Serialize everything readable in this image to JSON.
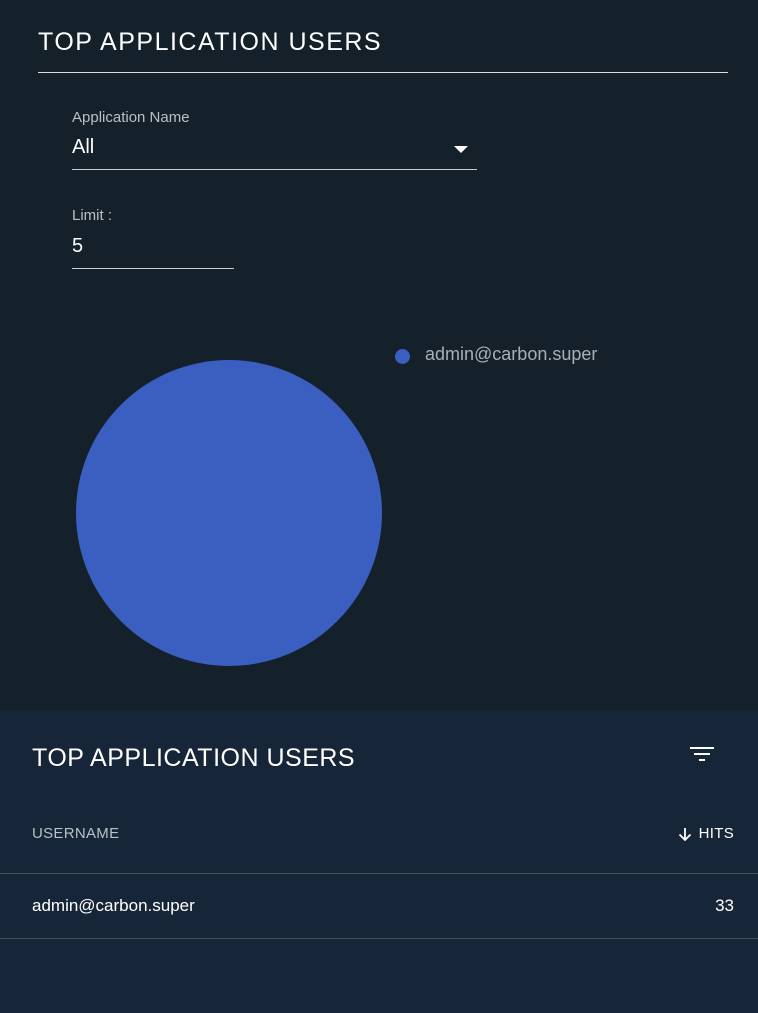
{
  "top_panel": {
    "title": "TOP APPLICATION USERS",
    "app_name_label": "Application Name",
    "app_name_value": "All",
    "limit_label": "Limit :",
    "limit_value": "5"
  },
  "chart_data": {
    "type": "pie",
    "categories": [
      "admin@carbon.super"
    ],
    "values": [
      33
    ],
    "colors": [
      "#3a5fc0"
    ],
    "legend_placement": "right"
  },
  "table": {
    "title": "TOP APPLICATION USERS",
    "filter_icon": "filter-list-icon",
    "columns": [
      "USERNAME",
      "HITS"
    ],
    "sort_icon": "arrow-down-icon",
    "rows": [
      {
        "username": "admin@carbon.super",
        "hits": "33"
      }
    ]
  },
  "colors": {
    "top_background": "#14202a",
    "bottom_background": "#172538",
    "series": "#3a5fc0"
  }
}
